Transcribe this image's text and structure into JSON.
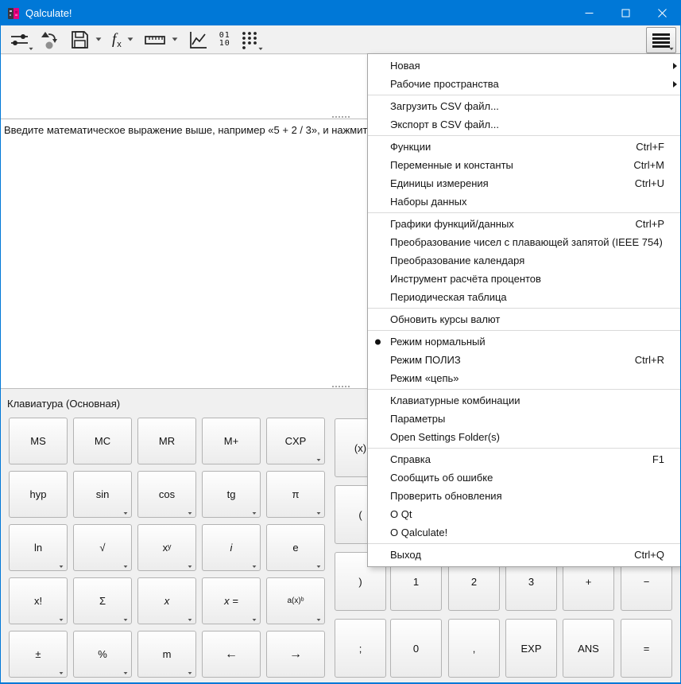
{
  "window": {
    "title": "Qalculate!",
    "accent_color": "#0078d7",
    "controls": [
      {
        "name": "minimize",
        "icon": "minimize-icon"
      },
      {
        "name": "maximize",
        "icon": "maximize-icon"
      },
      {
        "name": "close",
        "icon": "close-icon"
      }
    ]
  },
  "toolbar": {
    "buttons": [
      {
        "name": "mode",
        "icon": "sliders-icon",
        "dropdown": "corner"
      },
      {
        "name": "workspace",
        "icon": "workspace-icon",
        "dropdown": "none"
      },
      {
        "name": "save",
        "icon": "floppy-icon",
        "dropdown": "side"
      },
      {
        "name": "functions",
        "icon": "fx-icon",
        "dropdown": "side",
        "glyph": {
          "main": "f",
          "sub": "x"
        }
      },
      {
        "name": "units",
        "icon": "ruler-icon",
        "dropdown": "side"
      },
      {
        "name": "plot",
        "icon": "chart-icon",
        "dropdown": "none"
      },
      {
        "name": "number-bases",
        "icon": "binary-icon",
        "dropdown": "none",
        "glyph": {
          "line1": "01",
          "line2": "10"
        }
      },
      {
        "name": "keypad-toggle",
        "icon": "keypad-icon",
        "dropdown": "corner"
      }
    ],
    "menu_button": {
      "name": "main-menu",
      "icon": "hamburger-icon",
      "pressed": true
    }
  },
  "expression_area": {
    "value": ""
  },
  "history": {
    "hint": "Введите математическое выражение выше, например «5 + 2 / 3», и нажмите клави"
  },
  "keypad": {
    "label": "Клавиатура (Основная)",
    "left_grid": {
      "rows": [
        [
          {
            "label": "MS"
          },
          {
            "label": "MC"
          },
          {
            "label": "MR"
          },
          {
            "label": "M+"
          },
          {
            "label": "CXP",
            "dropdown": true
          }
        ],
        [
          {
            "label": "hyp"
          },
          {
            "label": "sin",
            "dropdown": true
          },
          {
            "label": "cos",
            "dropdown": true
          },
          {
            "label": "tg",
            "dropdown": true
          },
          {
            "label": "π",
            "dropdown": true
          }
        ],
        [
          {
            "label": "ln",
            "dropdown": true
          },
          {
            "label": "√",
            "dropdown": true
          },
          {
            "label": "xʸ",
            "dropdown": true
          },
          {
            "label": "i",
            "italic": true,
            "dropdown": true
          },
          {
            "label": "e",
            "dropdown": true
          }
        ],
        [
          {
            "label": "x!",
            "dropdown": true
          },
          {
            "label": "Σ",
            "dropdown": true
          },
          {
            "label": "x",
            "italic": true,
            "dropdown": true
          },
          {
            "label": "x =",
            "italic": true,
            "dropdown": true
          },
          {
            "label": "a(x)ᵇ",
            "small": true,
            "dropdown": true
          }
        ],
        [
          {
            "label": "±",
            "dropdown": true
          },
          {
            "label": "%",
            "dropdown": true
          },
          {
            "label": "m",
            "dropdown": true
          },
          {
            "label": "←",
            "arrow": true
          },
          {
            "label": "→",
            "arrow": true
          }
        ]
      ]
    },
    "right_grid": {
      "buttons": [
        {
          "label": "(x)",
          "col": 0,
          "row": 0
        },
        {
          "label": "(",
          "col": 0,
          "row": 1
        },
        {
          "label": ")",
          "col": 0,
          "row": 2
        },
        {
          "label": ";",
          "col": 0,
          "row": 3
        },
        {
          "label": "1",
          "col": 1,
          "row": 2
        },
        {
          "label": "0",
          "col": 1,
          "row": 3
        },
        {
          "label": "2",
          "col": 2,
          "row": 2
        },
        {
          "label": ",",
          "col": 2,
          "row": 3
        },
        {
          "label": "3",
          "col": 3,
          "row": 2
        },
        {
          "label": "EXP",
          "col": 3,
          "row": 3
        },
        {
          "label": "+",
          "col": 4,
          "row": 2
        },
        {
          "label": "ANS",
          "col": 4,
          "row": 3
        },
        {
          "label": "−",
          "col": 5,
          "row": 2
        },
        {
          "label": "=",
          "col": 5,
          "row": 3
        }
      ]
    }
  },
  "menu": {
    "items": [
      {
        "label": "Новая",
        "submenu": true
      },
      {
        "label": "Рабочие пространства",
        "submenu": true
      },
      {
        "separator": true
      },
      {
        "label": "Загрузить CSV файл..."
      },
      {
        "label": "Экспорт в CSV файл..."
      },
      {
        "separator": true
      },
      {
        "label": "Функции",
        "shortcut": "Ctrl+F"
      },
      {
        "label": "Переменные и константы",
        "shortcut": "Ctrl+M"
      },
      {
        "label": "Единицы измерения",
        "shortcut": "Ctrl+U"
      },
      {
        "label": "Наборы данных"
      },
      {
        "separator": true
      },
      {
        "label": "Графики функций/данных",
        "shortcut": "Ctrl+P"
      },
      {
        "label": "Преобразование чисел с плавающей запятой (IEEE 754)"
      },
      {
        "label": "Преобразование календаря"
      },
      {
        "label": "Инструмент расчёта процентов"
      },
      {
        "label": "Периодическая таблица"
      },
      {
        "separator": true
      },
      {
        "label": "Обновить курсы валют"
      },
      {
        "separator": true
      },
      {
        "label": "Режим нормальный",
        "radio": true
      },
      {
        "label": "Режим ПОЛИЗ",
        "shortcut": "Ctrl+R"
      },
      {
        "label": "Режим «цепь»"
      },
      {
        "separator": true
      },
      {
        "label": "Клавиатурные комбинации"
      },
      {
        "label": "Параметры"
      },
      {
        "label": "Open Settings Folder(s)"
      },
      {
        "separator": true
      },
      {
        "label": "Справка",
        "shortcut": "F1"
      },
      {
        "label": "Сообщить об ошибке"
      },
      {
        "label": "Проверить обновления"
      },
      {
        "label": "О Qt"
      },
      {
        "label": "О Qalculate!"
      },
      {
        "separator": true
      },
      {
        "label": "Выход",
        "shortcut": "Ctrl+Q"
      }
    ]
  }
}
